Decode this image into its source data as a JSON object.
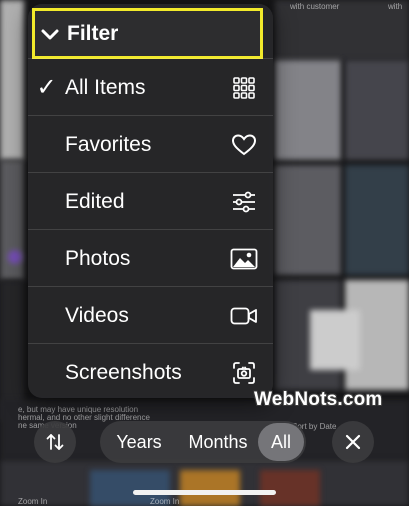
{
  "menu": {
    "header_title": "Filter",
    "items": [
      {
        "label": "All Items",
        "checked": true,
        "icon": "grid-icon"
      },
      {
        "label": "Favorites",
        "checked": false,
        "icon": "heart-icon"
      },
      {
        "label": "Edited",
        "checked": false,
        "icon": "sliders-icon"
      },
      {
        "label": "Photos",
        "checked": false,
        "icon": "photo-icon"
      },
      {
        "label": "Videos",
        "checked": false,
        "icon": "video-camera-icon"
      },
      {
        "label": "Screenshots",
        "checked": false,
        "icon": "screenshot-icon"
      }
    ],
    "check_glyph": "✓",
    "highlight_color": "#f2ea2b"
  },
  "toolbar": {
    "sort_icon": "sort-arrows-icon",
    "segments": [
      "Years",
      "Months",
      "All"
    ],
    "selected_segment": "All",
    "close_icon": "close-icon"
  },
  "watermark": "WebNots.com",
  "background_text": {
    "top_right": "with customer",
    "bottom_left": "Zoom In",
    "bottom_right": "Sort by Date",
    "edge_right": "with",
    "left_fragment_1": "e, but may have unique resolution",
    "left_fragment_2": "hermal, and no other slight difference",
    "left_fragment_3": "ne same version"
  }
}
